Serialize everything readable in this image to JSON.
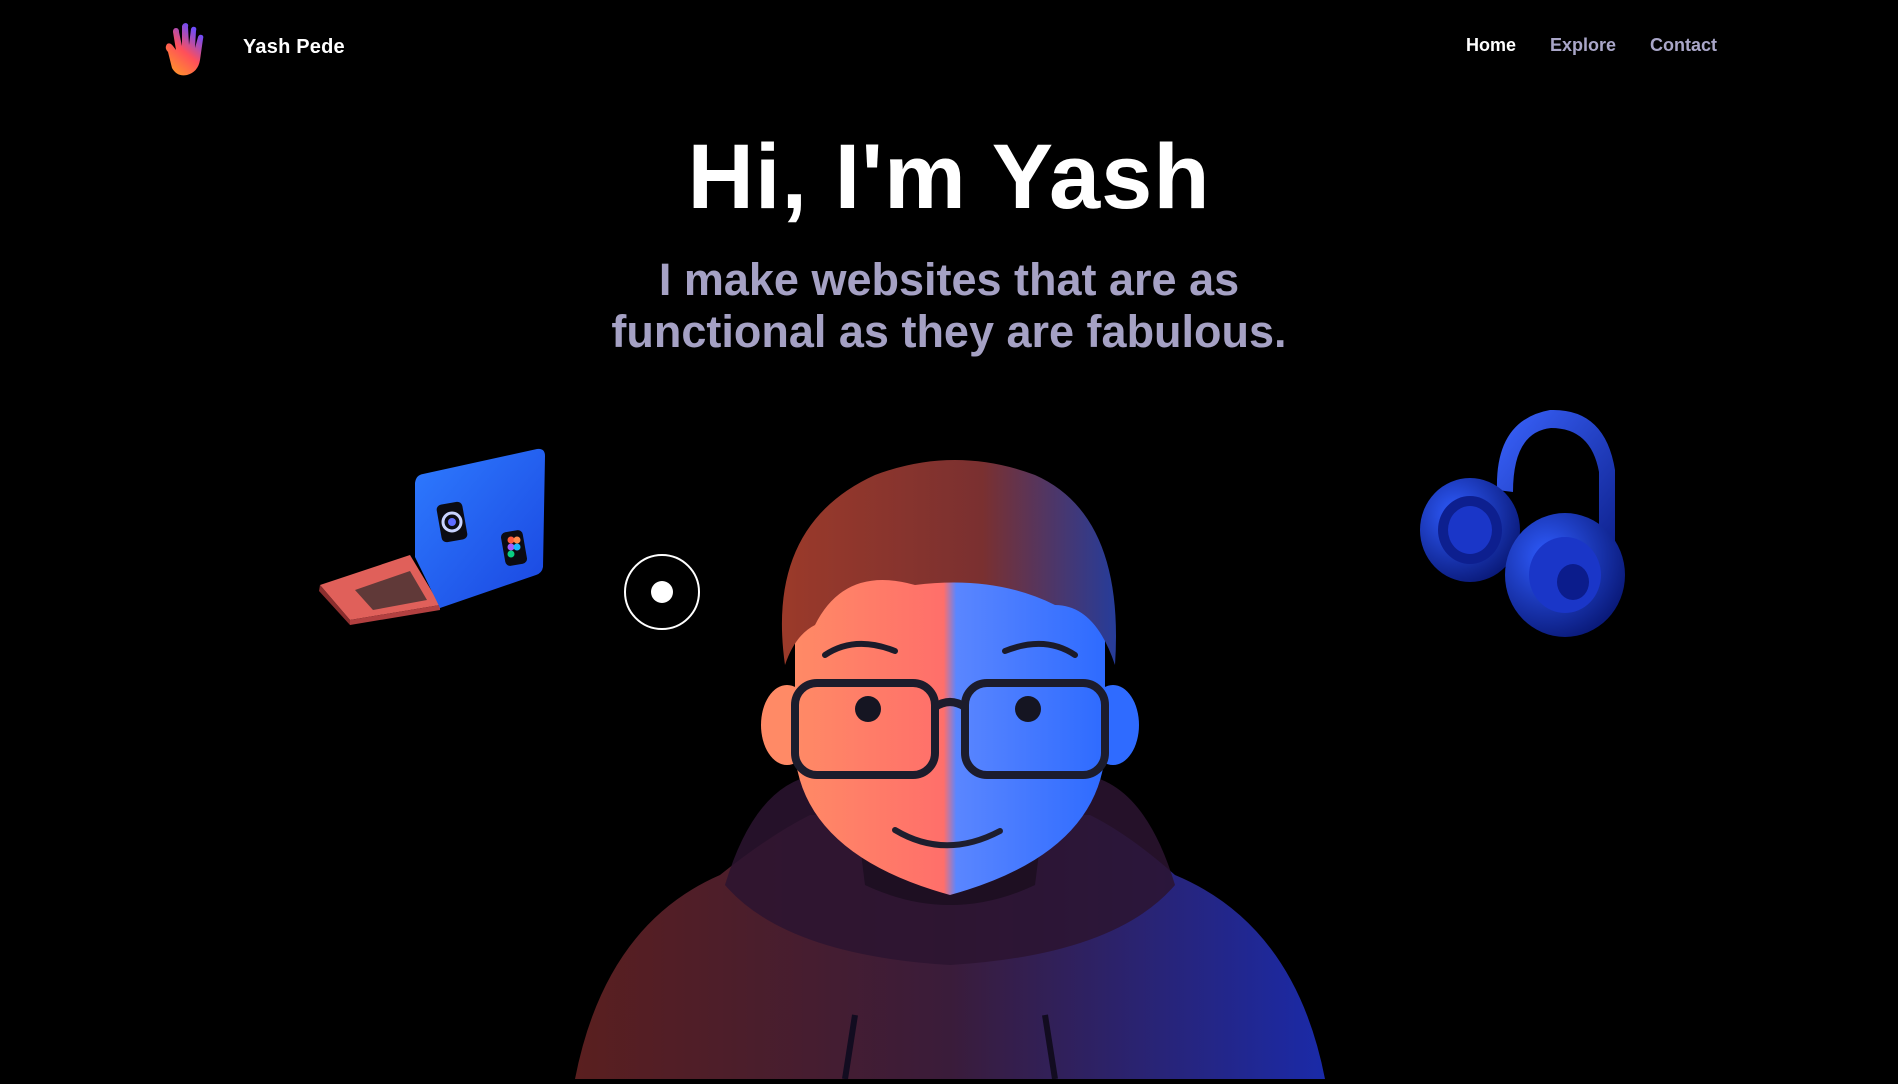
{
  "header": {
    "logo_icon": "waving-hand-icon",
    "brand": "Yash Pede",
    "nav": [
      {
        "label": "Home",
        "active": true
      },
      {
        "label": "Explore",
        "active": false
      },
      {
        "label": "Contact",
        "active": false
      }
    ]
  },
  "hero": {
    "title": "Hi, I'm Yash",
    "subtitle_line1": "I make websites that are as",
    "subtitle_line2": "functional as they are fabulous."
  },
  "illustrations": {
    "laptop_icon": "laptop-icon",
    "headphones_icon": "headphones-icon",
    "avatar_icon": "avatar-illustration"
  },
  "colors": {
    "background": "#000000",
    "text_primary": "#ffffff",
    "text_muted": "#a9a6c8",
    "accent_blue": "#2f5cff",
    "accent_orange": "#ff6a4a"
  }
}
